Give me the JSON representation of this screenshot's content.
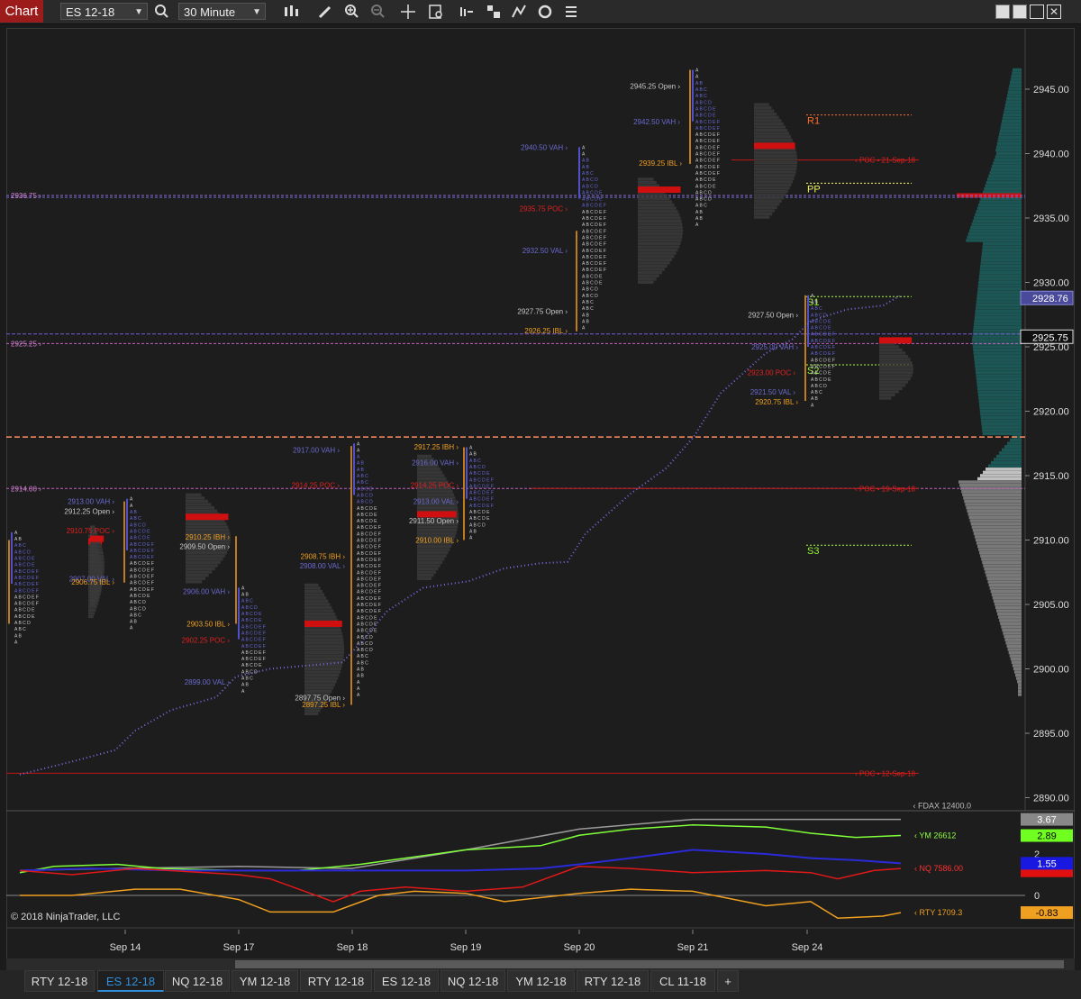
{
  "toolbar": {
    "chart_tab": "Chart",
    "instrument": "ES 12-18",
    "interval": "30 Minute",
    "icons": [
      "search-icon",
      "bar-type-icon",
      "draw-pencil-icon",
      "zoom-in-icon",
      "zoom-out-icon",
      "crosshair-icon",
      "data-box-icon",
      "indicators-icon",
      "strategies-icon",
      "templates-icon",
      "reload-icon",
      "properties-icon"
    ]
  },
  "window": {
    "buttons": [
      "restore-icon",
      "minimize-icon",
      "maximize-icon",
      "close-icon"
    ]
  },
  "price_axis": {
    "ticks": [
      "2945.00",
      "2940.00",
      "2935.00",
      "2930.00",
      "2925.00",
      "2920.00",
      "2915.00",
      "2910.00",
      "2905.00",
      "2900.00",
      "2895.00",
      "2890.00"
    ],
    "current_price": "2925.75",
    "vwap_price": "2928.76"
  },
  "time_axis": {
    "ticks": [
      "Sep 14",
      "Sep 17",
      "Sep 18",
      "Sep 19",
      "Sep 20",
      "Sep 21",
      "Sep 24"
    ]
  },
  "lines": {
    "left_2936": "2936.75",
    "left_2925": "2925.25",
    "left_2914": "2914.00",
    "poc_21": "POC • 21-Sep-18",
    "poc_19": "POC • 19-Sep-18",
    "poc_12": "POC • 12-Sep-18"
  },
  "pivots": {
    "r1": "R1",
    "pp": "PP",
    "s1": "S1",
    "s2": "S2",
    "s3": "S3"
  },
  "profile_labels": [
    {
      "text": "2945.25 Open",
      "cls": "open"
    },
    {
      "text": "2942.50 VAH",
      "cls": "va"
    },
    {
      "text": "2939.25 IBL",
      "cls": "ib"
    },
    {
      "text": "2940.50 VAH",
      "cls": "va"
    },
    {
      "text": "2935.75 POC",
      "cls": "poc"
    },
    {
      "text": "2932.50 VAL",
      "cls": "va"
    },
    {
      "text": "2927.75 Open",
      "cls": "open"
    },
    {
      "text": "2926.25 IBL",
      "cls": "ib"
    },
    {
      "text": "2927.50 Open",
      "cls": "open"
    },
    {
      "text": "2925.00 VAH",
      "cls": "va"
    },
    {
      "text": "2923.00 POC",
      "cls": "poc"
    },
    {
      "text": "2921.50 VAL",
      "cls": "va"
    },
    {
      "text": "2920.75 IBL",
      "cls": "ib"
    },
    {
      "text": "2917.25 IBH",
      "cls": "ib"
    },
    {
      "text": "2917.00 VAH",
      "cls": "va"
    },
    {
      "text": "2916.00 VAH",
      "cls": "va"
    },
    {
      "text": "2914.25 POC",
      "cls": "poc"
    },
    {
      "text": "2914.25 POC",
      "cls": "poc"
    },
    {
      "text": "2913.00 VAL",
      "cls": "va"
    },
    {
      "text": "2911.50 Open",
      "cls": "open"
    },
    {
      "text": "2910.00 IBL",
      "cls": "ib"
    },
    {
      "text": "2913.00 VAH",
      "cls": "va"
    },
    {
      "text": "2912.25 Open",
      "cls": "open"
    },
    {
      "text": "2910.75 POC",
      "cls": "poc"
    },
    {
      "text": "2907.00 VAL",
      "cls": "va"
    },
    {
      "text": "2906.75 IBL",
      "cls": "ib"
    },
    {
      "text": "2910.25 IBH",
      "cls": "ib"
    },
    {
      "text": "2909.50 Open",
      "cls": "open"
    },
    {
      "text": "2906.00 VAH",
      "cls": "va"
    },
    {
      "text": "2903.50 IBL",
      "cls": "ib"
    },
    {
      "text": "2902.25 POC",
      "cls": "poc"
    },
    {
      "text": "2899.00 VAL",
      "cls": "va"
    },
    {
      "text": "2908.75 IBH",
      "cls": "ib"
    },
    {
      "text": "2908.00 VAL",
      "cls": "va"
    },
    {
      "text": "2897.75 Open",
      "cls": "open"
    },
    {
      "text": "2897.25 IBL",
      "cls": "ib"
    }
  ],
  "lower_panel": {
    "fdax_label": "FDAX 12400.0",
    "fdax_value": "3.67",
    "ym_label": "YM 26612",
    "ym_value": "2.89",
    "nq_label": "NQ 7586.00",
    "nq_value": "1.55",
    "rty_label": "RTY 1709.3",
    "rty_value": "-0.83",
    "axis_2": "2",
    "axis_0": "0",
    "colors": {
      "fdax": "#9a9a9a",
      "ym": "#7fff3a",
      "nq_blue": "#2a2ad8",
      "nq_red": "#e01818",
      "rty": "#f0a020"
    }
  },
  "copyright": "© 2018 NinjaTrader, LLC",
  "bottom_tabs": [
    "RTY 12-18",
    "ES 12-18",
    "NQ 12-18",
    "YM 12-18",
    "RTY 12-18",
    "ES 12-18",
    "NQ 12-18",
    "YM 12-18",
    "RTY 12-18",
    "CL 11-18"
  ],
  "active_tab_index": 1,
  "add_tab": "+"
}
